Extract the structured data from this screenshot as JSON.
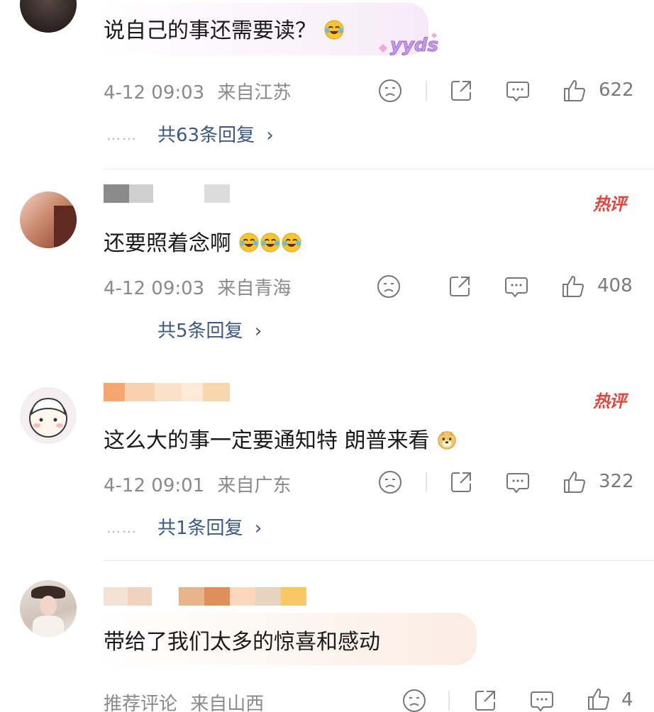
{
  "comments": [
    {
      "text": "说自己的事还需要读？",
      "timestamp": "4-12 09:03",
      "location": "来自江苏",
      "likes": "622",
      "replies": "共63条回复",
      "reply_dots": "……",
      "sticker": "yyds"
    },
    {
      "text": "还要照着念啊",
      "badge": "热评",
      "timestamp": "4-12 09:03",
      "location": "来自青海",
      "likes": "408",
      "replies": "共5条回复"
    },
    {
      "text": "这么大的事一定要通知特 朗普来看",
      "badge": "热评",
      "timestamp": "4-12 09:01",
      "location": "来自广东",
      "likes": "322",
      "replies": "共1条回复",
      "reply_dots": "……"
    },
    {
      "text": "带给了我们太多的惊喜和感动",
      "recommend": "推荐评论",
      "location": "来自山西",
      "likes": "4"
    }
  ],
  "reply_chevron": "›",
  "colors": {
    "link": "#3b5889",
    "hot": "#e0463b",
    "meta": "#8a8a8a"
  },
  "icons": [
    "dislike-face-icon",
    "share-icon",
    "comment-icon",
    "thumbs-up-icon",
    "laugh-cry-emoji",
    "doge-emoji"
  ]
}
